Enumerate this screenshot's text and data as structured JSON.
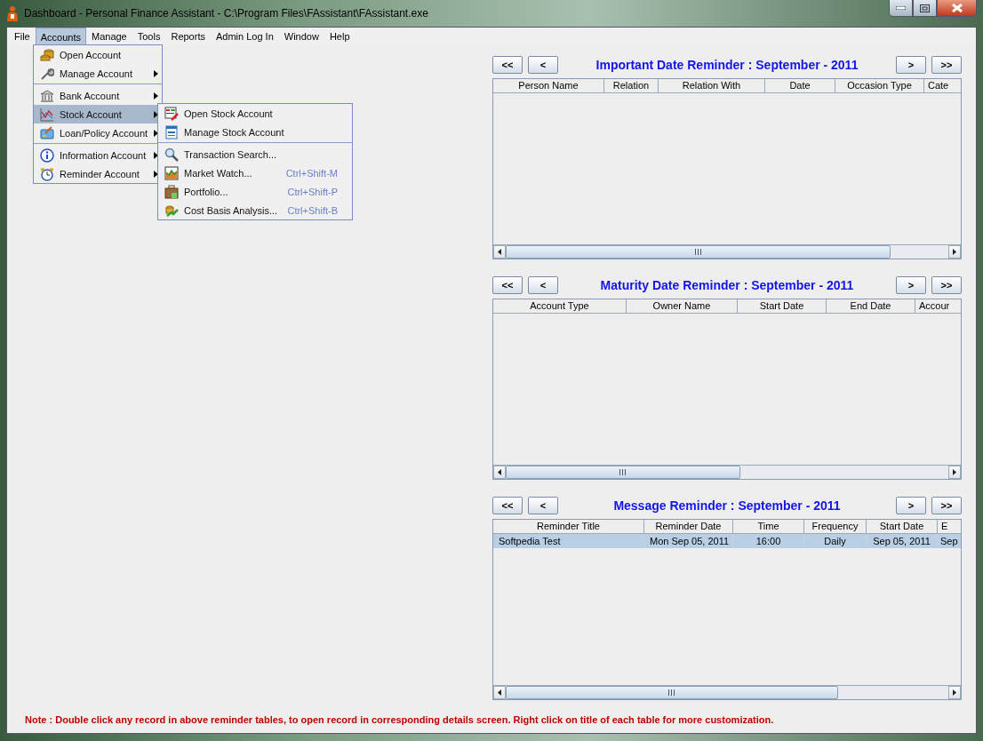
{
  "window": {
    "title": "Dashboard - Personal Finance Assistant - C:\\Program Files\\FAssistant\\FAssistant.exe"
  },
  "menu_bar": [
    {
      "label": "File",
      "selected": false
    },
    {
      "label": "Accounts",
      "selected": true
    },
    {
      "label": "Manage",
      "selected": false
    },
    {
      "label": "Tools",
      "selected": false
    },
    {
      "label": "Reports",
      "selected": false
    },
    {
      "label": "Admin Log In",
      "selected": false
    },
    {
      "label": "Window",
      "selected": false
    },
    {
      "label": "Help",
      "selected": false
    }
  ],
  "accounts_menu": {
    "groups": [
      [
        {
          "label": "Open Account",
          "submenu": false,
          "selected": false
        },
        {
          "label": "Manage Account",
          "submenu": true,
          "selected": false
        }
      ],
      [
        {
          "label": "Bank Account",
          "submenu": true,
          "selected": false
        },
        {
          "label": "Stock Account",
          "submenu": true,
          "selected": true
        },
        {
          "label": "Loan/Policy Account",
          "submenu": true,
          "selected": false
        }
      ],
      [
        {
          "label": "Information Account",
          "submenu": true,
          "selected": false
        },
        {
          "label": "Reminder Account",
          "submenu": true,
          "selected": false
        }
      ]
    ]
  },
  "stock_submenu": {
    "groups": [
      [
        {
          "label": "Open Stock Account"
        },
        {
          "label": "Manage Stock Account"
        }
      ],
      [
        {
          "label": "Transaction Search..."
        },
        {
          "label": "Market Watch...",
          "shortcut": "Ctrl+Shift-M"
        },
        {
          "label": "Portfolio...",
          "shortcut": "Ctrl+Shift-P"
        },
        {
          "label": "Cost Basis Analysis...",
          "shortcut": "Ctrl+Shift-B"
        }
      ]
    ]
  },
  "panels": [
    {
      "title": "Important Date Reminder : September - 2011",
      "nav": [
        "<<",
        "<",
        ">",
        ">>"
      ],
      "columns": [
        "Person Name",
        "Relation",
        "Relation With",
        "Date",
        "Occasion Type",
        "Cate"
      ]
    },
    {
      "title": "Maturity Date Reminder : September - 2011",
      "nav": [
        "<<",
        "<",
        ">",
        ">>"
      ],
      "columns": [
        "Account Type",
        "Owner Name",
        "Start Date",
        "End Date",
        "Accour"
      ]
    },
    {
      "title": "Message Reminder : September - 2011",
      "nav": [
        "<<",
        "<",
        ">",
        ">>"
      ],
      "columns": [
        "Reminder Title",
        "Reminder Date",
        "Time",
        "Frequency",
        "Start Date",
        "E"
      ],
      "rows": [
        {
          "cells": [
            "Softpedia Test",
            "Mon Sep 05, 2011",
            "16:00",
            "Daily",
            "Sep 05, 2011",
            "Sep"
          ],
          "selected": true
        }
      ]
    }
  ],
  "note": "Note : Double click any record in above reminder tables, to open record in corresponding details screen. Right click on title of each table for more customization."
}
